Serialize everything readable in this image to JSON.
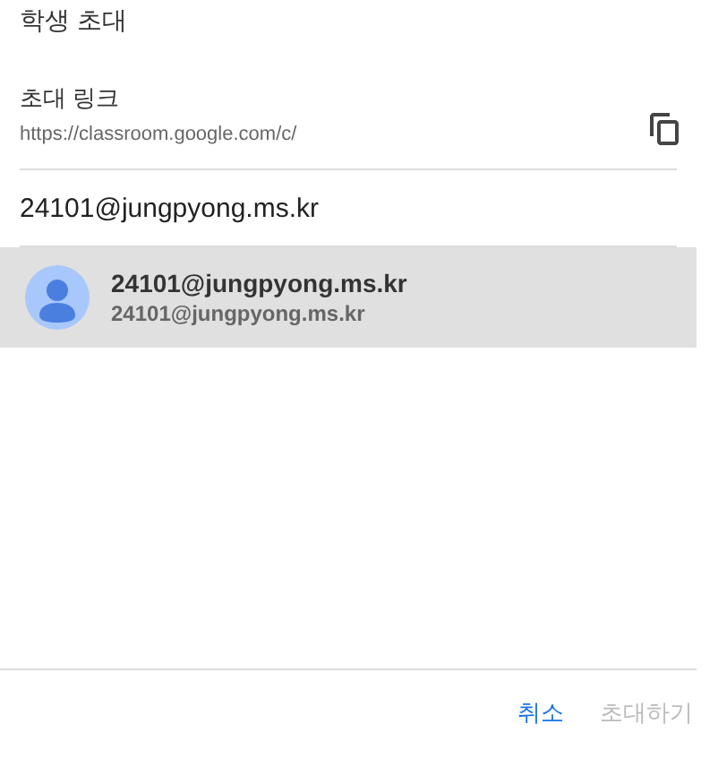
{
  "dialog": {
    "title": "학생 초대"
  },
  "invite_link": {
    "label": "초대 링크",
    "url": "https://classroom.google.com/c/"
  },
  "email_input": {
    "value": "24101@jungpyong.ms.kr"
  },
  "suggestions": [
    {
      "name": "24101@jungpyong.ms.kr",
      "email": "24101@jungpyong.ms.kr",
      "selected": true
    }
  ],
  "buttons": [
    {
      "label": "취소",
      "disabled": false
    },
    {
      "label": "초대하기",
      "disabled": true
    }
  ]
}
